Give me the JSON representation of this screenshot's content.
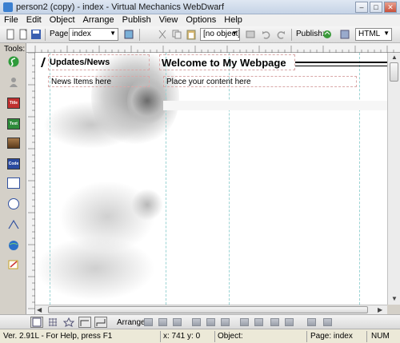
{
  "window": {
    "title": "person2 (copy) - index - Virtual Mechanics WebDwarf",
    "minimize": "‒",
    "maximize": "□",
    "close": "✕"
  },
  "menu": [
    "File",
    "Edit",
    "Object",
    "Arrange",
    "Publish",
    "View",
    "Options",
    "Help"
  ],
  "toolbar": {
    "page_label": "Page:",
    "page_value": "index",
    "object_value": "[no object]",
    "publish_label": "Publish:",
    "format_value": "HTML"
  },
  "tools": {
    "label": "Tools:",
    "items": [
      {
        "name": "select-tool-icon",
        "text": "",
        "color": "#2e9b3a"
      },
      {
        "name": "person-tool-icon",
        "text": "",
        "color": "#9a9a9a"
      },
      {
        "name": "title-tool-icon",
        "text": "Title",
        "color": "#c03030"
      },
      {
        "name": "text-tool-icon",
        "text": "Text",
        "color": "#2e8b3a"
      },
      {
        "name": "image-tool-icon",
        "text": "",
        "color": "#8a5a2a"
      },
      {
        "name": "code-tool-icon",
        "text": "Code",
        "color": "#2a4aa0"
      },
      {
        "name": "rectangle-tool-icon",
        "text": "",
        "color": "#3050a0"
      },
      {
        "name": "ellipse-tool-icon",
        "text": "",
        "color": "#3050a0"
      },
      {
        "name": "polygon-tool-icon",
        "text": "",
        "color": "#3050a0"
      },
      {
        "name": "globe-tool-icon",
        "text": "",
        "color": "#2a70c8"
      },
      {
        "name": "form-tool-icon",
        "text": "",
        "color": "#c8a020"
      }
    ]
  },
  "canvas": {
    "updates_heading": "Updates/News",
    "news_items": "News Items here",
    "main_heading": "Welcome to My Webpage",
    "content_placeholder": "Place your content here"
  },
  "bottom": {
    "arrange_label": "Arrange:"
  },
  "status": {
    "version": "Ver. 2.91L - For Help, press F1",
    "coords": "x: 741  y: 0",
    "object_label": "Object:",
    "page": "Page:  index",
    "num": "NUM"
  }
}
